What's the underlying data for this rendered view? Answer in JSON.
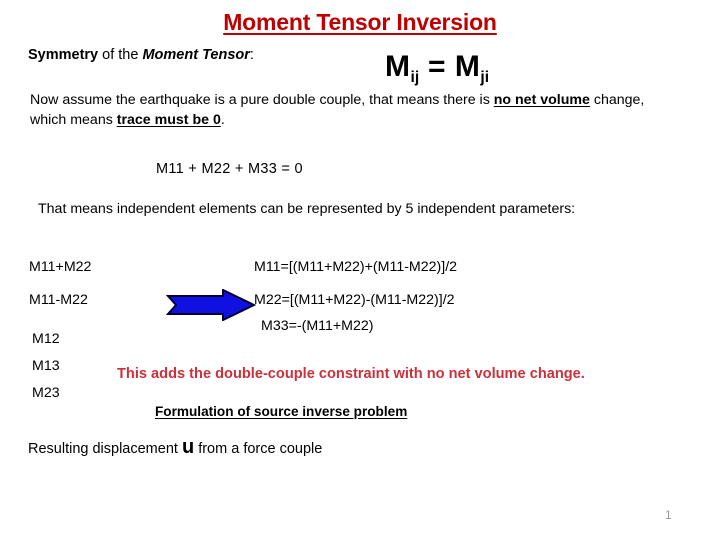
{
  "slide": {
    "title": "Moment Tensor Inversion",
    "title_color": "#C00000",
    "page_number": "1"
  },
  "symmetry": {
    "bold_word": "Symmetry",
    "connector": " of the ",
    "bold_italic_term": "Moment Tensor",
    "colon": ":"
  },
  "formula": {
    "m_left": "M",
    "sub_left": "ij",
    "equals": " = ",
    "m_right": "M",
    "sub_right": "ji",
    "full_text": "Mij = Mji"
  },
  "double_couple": {
    "part1": "Now assume the earthquake is a pure double couple, that means there is ",
    "emph1": "no net volume",
    "part2": " change, which means ",
    "emph2": "trace must be 0",
    "part3": "."
  },
  "trace": {
    "equation": "M11 + M22 + M33 = 0"
  },
  "independent": {
    "text": "That means independent elements can be represented by 5 independent parameters:"
  },
  "components": {
    "items": [
      {
        "label": "M11+M22"
      },
      {
        "label": "M11-M22"
      },
      {
        "label": "M12"
      },
      {
        "label": "M13"
      },
      {
        "label": "M23"
      }
    ]
  },
  "solved_equations": [
    {
      "text": "M11=[(M11+M22)+(M11-M22)]/2"
    },
    {
      "text": "M22=[(M11+M22)-(M11-M22)]/2"
    },
    {
      "text": "M33=-(M11+M22)"
    }
  ],
  "arrow": {
    "icon": "right-arrow-icon",
    "fill_color": "#1010E0",
    "stroke_color": "#000040"
  },
  "constraint_note": {
    "text": "This adds the double-couple constraint with no net volume change.",
    "color": "#CB303B"
  },
  "formulation": {
    "heading": "Formulation of source inverse problem"
  },
  "displacement": {
    "part1": "Resulting displacement ",
    "vector": "u",
    "part2": " from a force couple"
  }
}
